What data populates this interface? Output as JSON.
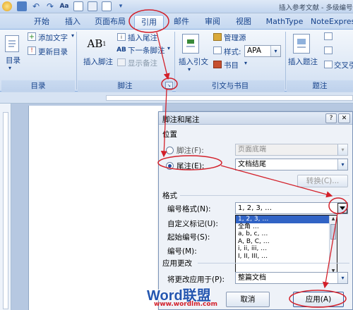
{
  "window": {
    "title": "插入参考文献 - 多级编号"
  },
  "tabs": [
    {
      "label": "开始"
    },
    {
      "label": "插入"
    },
    {
      "label": "页面布局"
    },
    {
      "label": "引用",
      "active": true
    },
    {
      "label": "邮件"
    },
    {
      "label": "审阅"
    },
    {
      "label": "视图"
    },
    {
      "label": "MathType"
    },
    {
      "label": "NoteExpress"
    }
  ],
  "ribbon": {
    "toc": {
      "label": "目录",
      "add_text": "添加文字",
      "update_toc": "更新目录",
      "group": "目录"
    },
    "footnotes": {
      "insert_footnote": "插入脚注",
      "insert_endnote": "插入尾注",
      "next_footnote": "下一条脚注",
      "show_notes": "显示备注",
      "group": "脚注"
    },
    "citations": {
      "insert_citation": "插入引文",
      "manage_sources": "管理源",
      "style_label": "样式:",
      "style_value": "APA",
      "bibliography": "书目",
      "group": "引文与书目"
    },
    "captions": {
      "insert_caption": "插入题注",
      "cross_reference": "交叉引",
      "group": "题注"
    }
  },
  "dialog": {
    "title": "脚注和尾注",
    "location": {
      "section": "位置",
      "footnote_label": "脚注(F):",
      "footnote_value": "页面底端",
      "endnote_label": "尾注(E):",
      "endnote_value": "文档结尾",
      "convert_button": "转换(C)..."
    },
    "format": {
      "section": "格式",
      "number_format_label": "编号格式(N):",
      "number_format_value": "1, 2, 3, …",
      "custom_mark_label": "自定义标记(U):",
      "start_at_label": "起始编号(S):",
      "numbering_label": "编号(M):",
      "options": [
        "1, 2, 3, …",
        "全角 …",
        "a, b, c, …",
        "A, B, C, …",
        "i, ii, iii, …",
        "I, II, III, …"
      ]
    },
    "apply": {
      "section": "应用更改",
      "apply_to_label": "将更改应用于(P):",
      "apply_to_value": "整篇文档"
    },
    "buttons": {
      "cancel": "取消",
      "apply": "应用(A)"
    }
  },
  "watermark": {
    "brand": "Word联盟",
    "url": "www.wordlm.com"
  },
  "colors": {
    "accent": "#15428b",
    "annotation": "#d3202a",
    "selection": "#3163c5"
  }
}
